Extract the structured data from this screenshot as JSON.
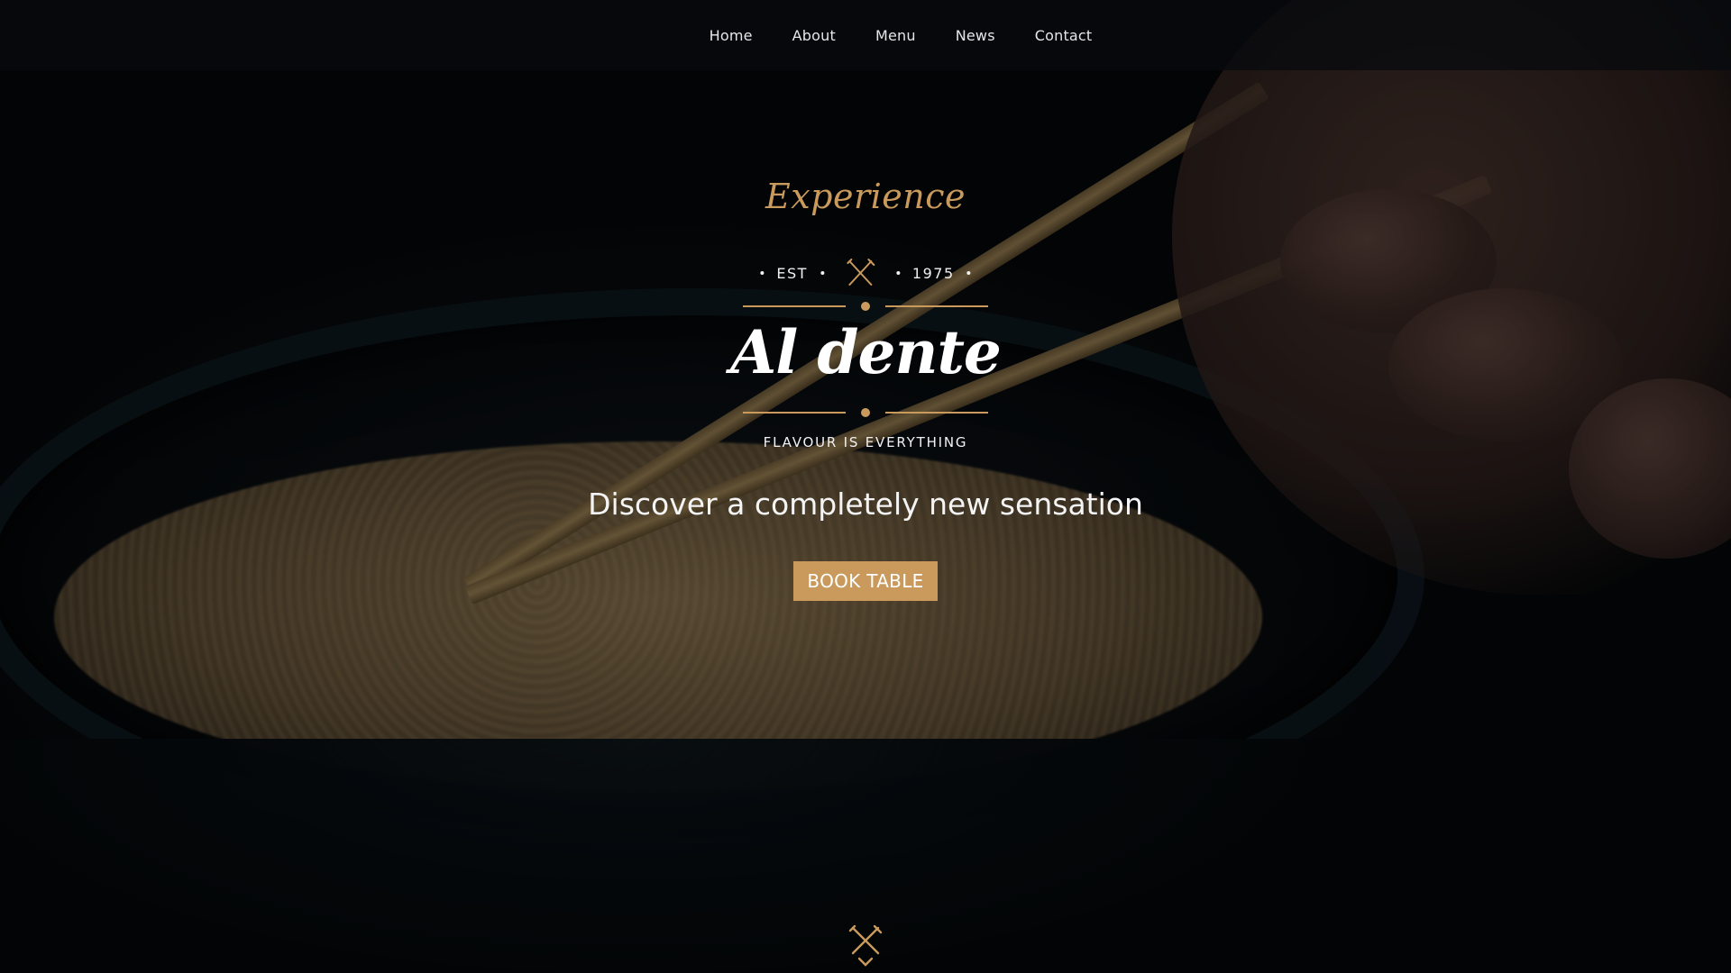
{
  "nav": {
    "items": [
      {
        "label": "Home"
      },
      {
        "label": "About"
      },
      {
        "label": "Menu"
      },
      {
        "label": "News"
      },
      {
        "label": "Contact"
      }
    ]
  },
  "hero": {
    "script_title": "Experience",
    "est_label": "EST",
    "est_year": "1975",
    "est_icon": "crossed-utensils-icon",
    "brand_name": "Al dente",
    "tagline": "FLAVOUR IS EVERYTHING",
    "headline": "Discover a completely new sensation",
    "cta_label": "BOOK TABLE",
    "scroll_icon": "crossed-utensils-chevron-icon"
  },
  "colors": {
    "accent": "#c99a5c",
    "nav_background": "#0a0c10",
    "text": "#f1f1f1"
  }
}
